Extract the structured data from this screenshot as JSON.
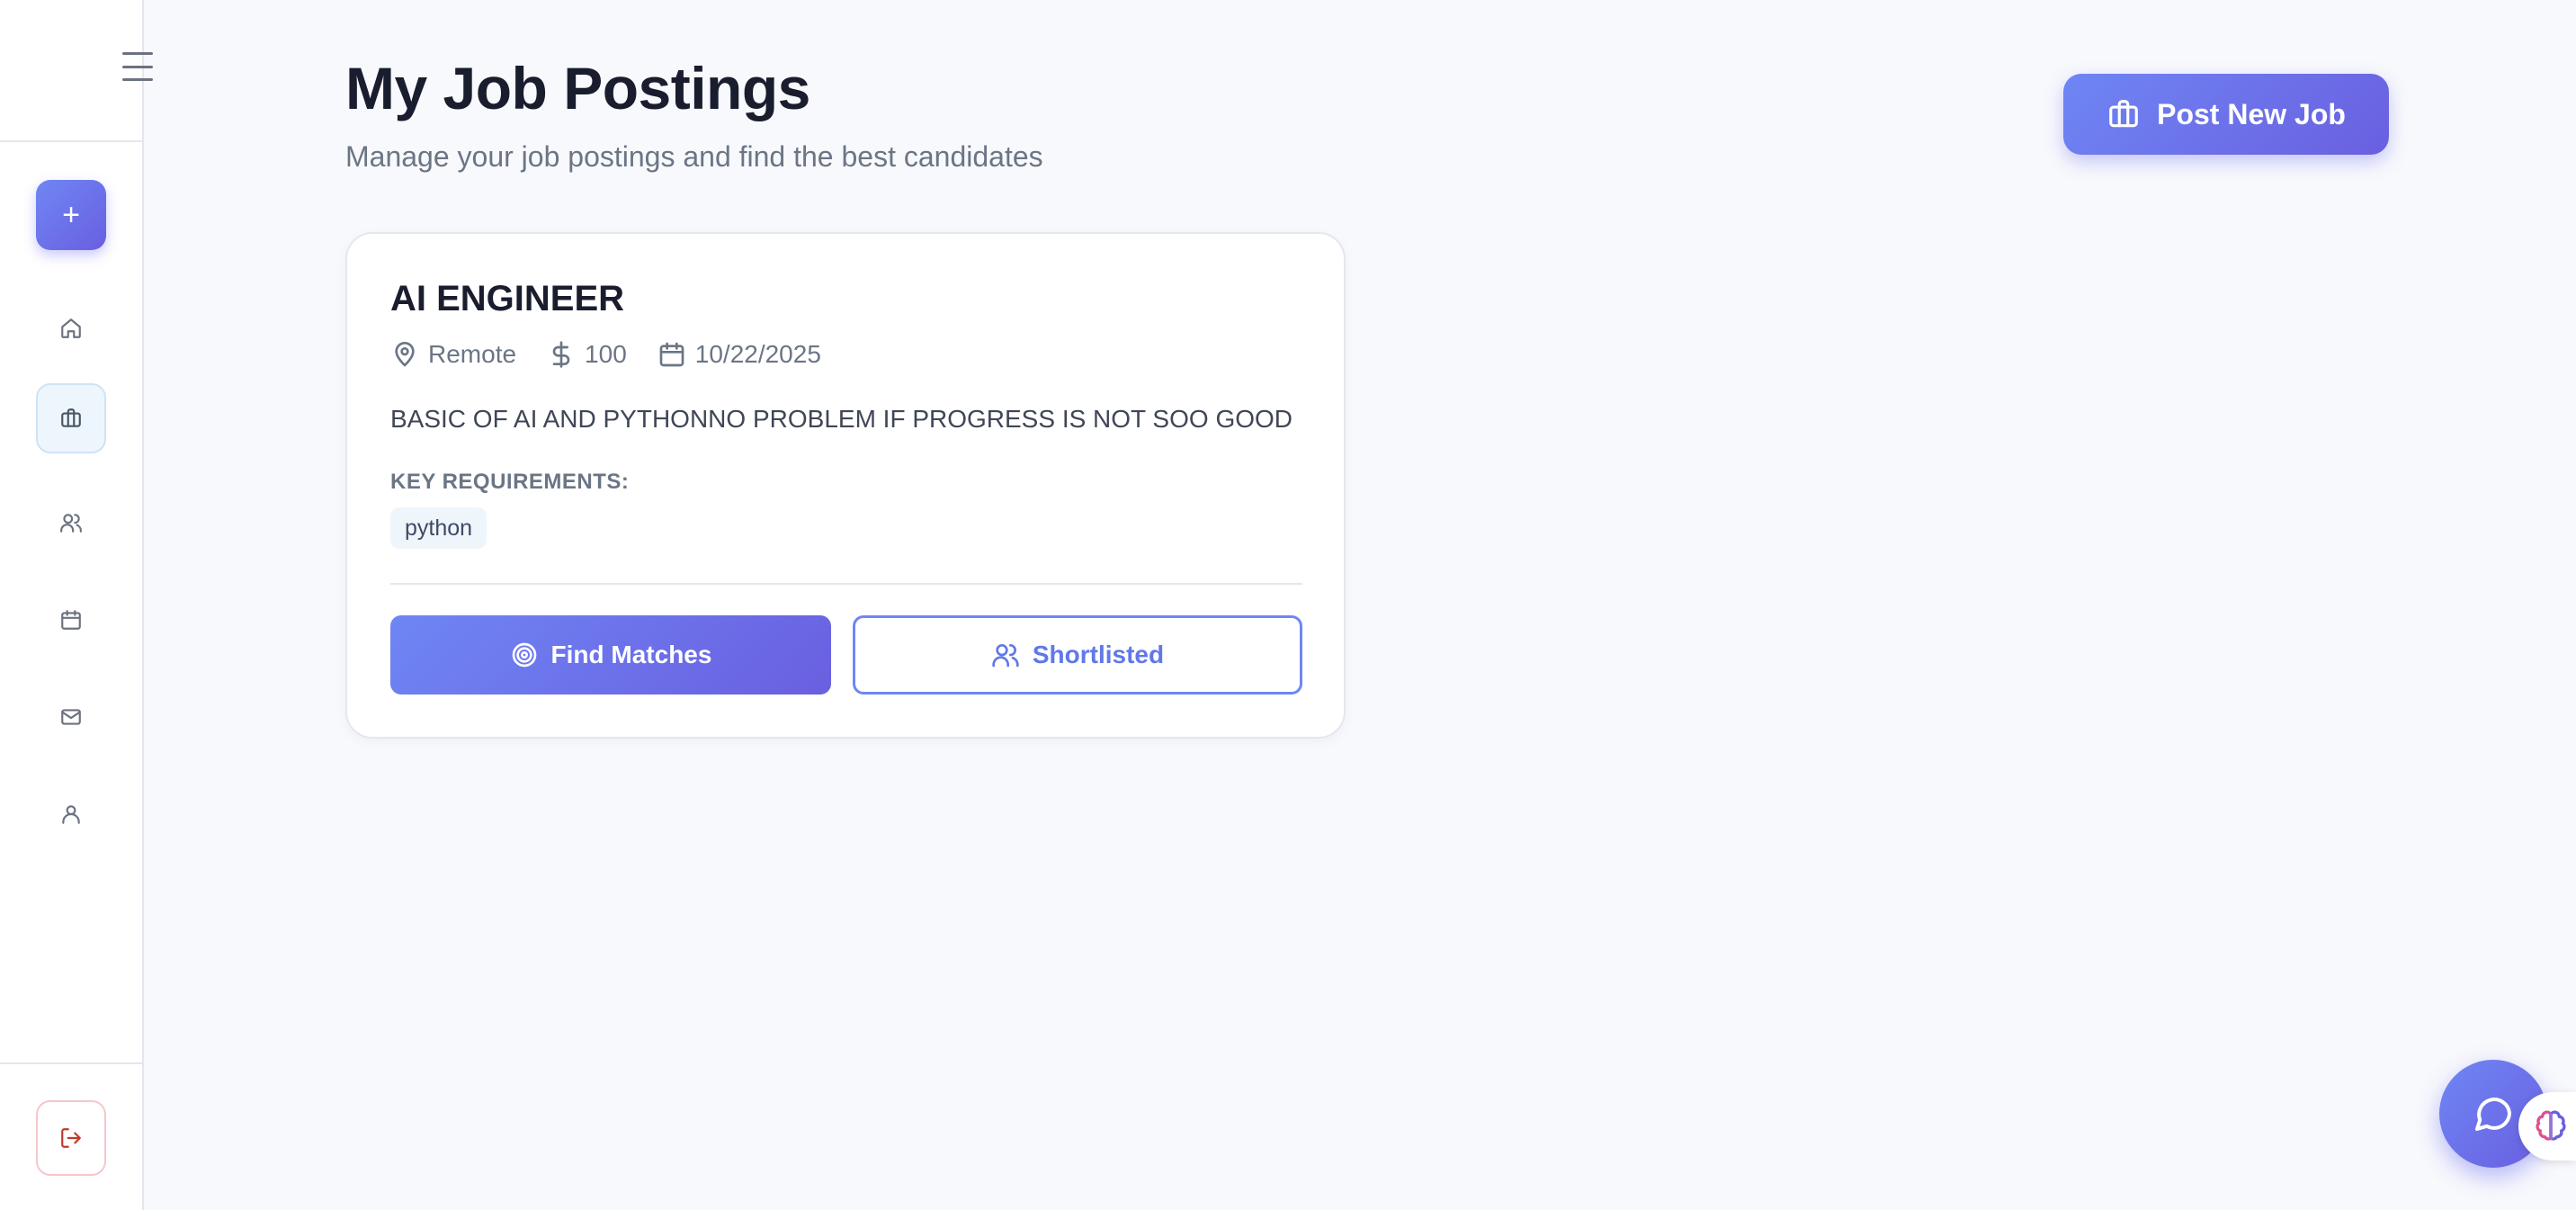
{
  "header": {
    "title": "My Job Postings",
    "subtitle": "Manage your job postings and find the best candidates",
    "post_button_label": "Post New Job"
  },
  "sidebar": {
    "add_label": "+",
    "items": [
      {
        "name": "home",
        "icon": "home-icon",
        "active": false
      },
      {
        "name": "jobs",
        "icon": "briefcase-icon",
        "active": true
      },
      {
        "name": "candidates",
        "icon": "users-icon",
        "active": false
      },
      {
        "name": "calendar",
        "icon": "calendar-icon",
        "active": false
      },
      {
        "name": "messages",
        "icon": "mail-icon",
        "active": false
      },
      {
        "name": "profile",
        "icon": "user-icon",
        "active": false
      }
    ],
    "logout_icon": "logout-icon"
  },
  "job": {
    "title": "AI ENGINEER",
    "location": "Remote",
    "salary": "100",
    "date": "10/22/2025",
    "description": "BASIC OF AI AND PYTHONNO PROBLEM IF PROGRESS IS NOT SOO GOOD",
    "requirements_label": "KEY REQUIREMENTS:",
    "requirements": [
      "python"
    ],
    "find_matches_label": "Find Matches",
    "shortlisted_label": "Shortlisted"
  },
  "colors": {
    "accent_start": "#6f86f4",
    "accent_end": "#6a5fe0",
    "logout": "#c0392b",
    "background": "#f8f9fc"
  }
}
